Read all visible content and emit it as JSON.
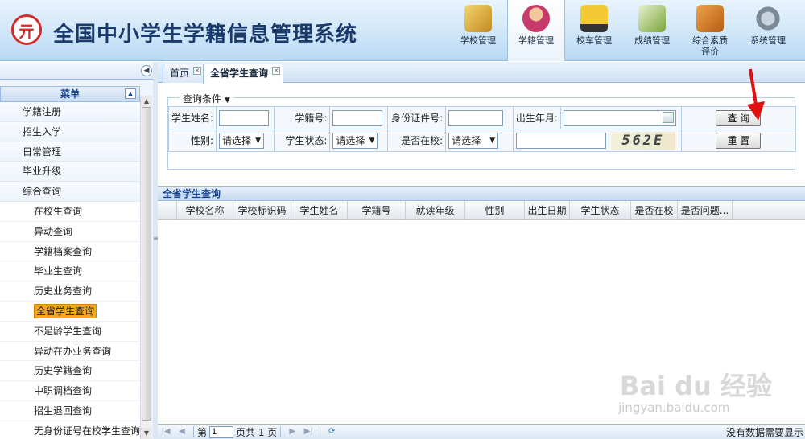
{
  "app": {
    "title": "全国中小学生学籍信息管理系统",
    "logo_glyph": "亓"
  },
  "topnav": [
    {
      "label": "学校管理",
      "icon": "school-icon"
    },
    {
      "label": "学籍管理",
      "icon": "student-icon",
      "active": true
    },
    {
      "label": "校车管理",
      "icon": "bus-icon"
    },
    {
      "label": "成绩管理",
      "icon": "grade-icon"
    },
    {
      "label": "综合素质\n评价",
      "icon": "quality-icon"
    },
    {
      "label": "系统管理",
      "icon": "system-icon"
    }
  ],
  "sidebar": {
    "header": "菜单",
    "items": [
      {
        "label": "学籍注册",
        "level": 1
      },
      {
        "label": "招生入学",
        "level": 1
      },
      {
        "label": "日常管理",
        "level": 1
      },
      {
        "label": "毕业升级",
        "level": 1
      },
      {
        "label": "综合查询",
        "level": 1
      },
      {
        "label": "在校生查询",
        "level": 2
      },
      {
        "label": "异动查询",
        "level": 2
      },
      {
        "label": "学籍档案查询",
        "level": 2
      },
      {
        "label": "毕业生查询",
        "level": 2
      },
      {
        "label": "历史业务查询",
        "level": 2
      },
      {
        "label": "全省学生查询",
        "level": 2,
        "selected": true
      },
      {
        "label": "不足龄学生查询",
        "level": 2
      },
      {
        "label": "异动在办业务查询",
        "level": 2
      },
      {
        "label": "历史学籍查询",
        "level": 2
      },
      {
        "label": "中职调档查询",
        "level": 2
      },
      {
        "label": "招生退回查询",
        "level": 2
      },
      {
        "label": "无身份证号在校学生查询",
        "level": 2
      }
    ]
  },
  "tabs": [
    {
      "label": "首页",
      "active": false
    },
    {
      "label": "全省学生查询",
      "active": true
    }
  ],
  "query": {
    "legend": "查询条件",
    "labels": {
      "name": "学生姓名:",
      "student_no": "学籍号:",
      "id_no": "身份证件号:",
      "birth": "出生年月:",
      "gender": "性别:",
      "status": "学生状态:",
      "in_school": "是否在校:"
    },
    "selects": {
      "gender": "请选择",
      "status": "请选择",
      "in_school": "请选择"
    },
    "captcha": "562E",
    "buttons": {
      "search": "查 询",
      "reset": "重 置"
    }
  },
  "grid": {
    "title": "全省学生查询",
    "columns": [
      "学校名称",
      "学校标识码",
      "学生姓名",
      "学籍号",
      "就读年级",
      "性别",
      "出生日期",
      "学生状态",
      "是否在校",
      "是否问题..."
    ]
  },
  "pager": {
    "page_prefix": "第",
    "page_value": "1",
    "page_suffix": "页共 1 页",
    "empty_msg": "没有数据需要显示"
  },
  "watermark": {
    "main": "Bai du 经验",
    "sub": "jingyan.baidu.com"
  }
}
